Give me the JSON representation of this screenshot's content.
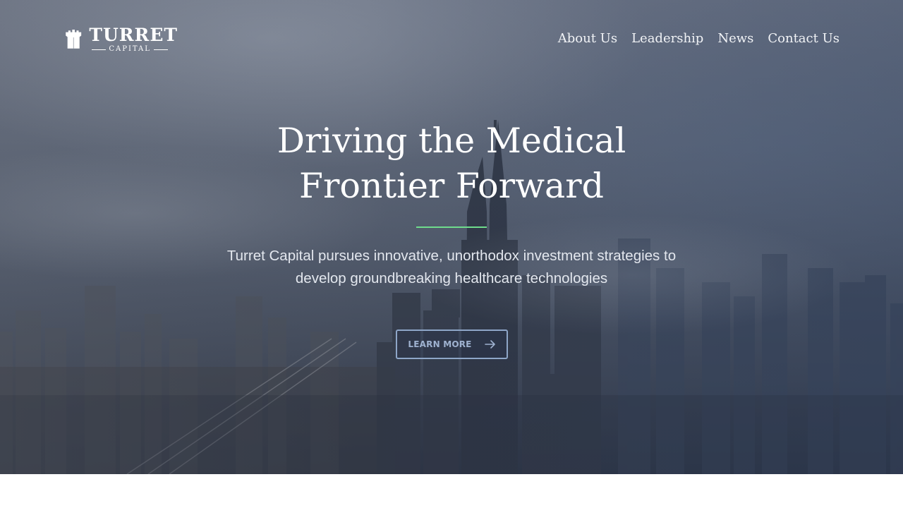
{
  "brand": {
    "name": "TURRET",
    "sub": "CAPITAL"
  },
  "nav": {
    "items": [
      {
        "label": "About Us"
      },
      {
        "label": "Leadership"
      },
      {
        "label": "News"
      },
      {
        "label": "Contact Us"
      }
    ]
  },
  "hero": {
    "headline_line1": "Driving the Medical",
    "headline_line2": "Frontier Forward",
    "subtitle_line1": "Turret Capital pursues innovative, unorthodox investment strategies to",
    "subtitle_line2": "develop groundbreaking healthcare technologies",
    "cta_label": "LEARN MORE",
    "cta_icon": "arrow-right-icon"
  },
  "colors": {
    "accent": "#6fdc8c",
    "cta_border": "#8ea6c8",
    "cta_text": "#9fb2d0",
    "text_light": "#ffffff"
  }
}
